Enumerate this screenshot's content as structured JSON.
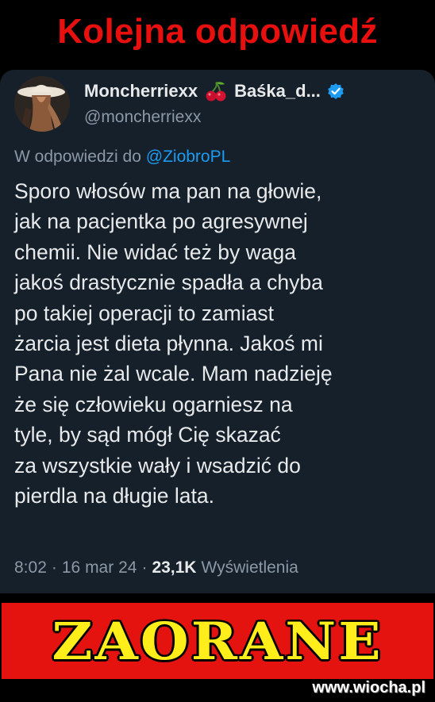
{
  "headline": "Kolejna odpowiedź",
  "tweet": {
    "display_name": "Moncherriexx",
    "display_name_suffix": "Baśka_d...",
    "handle": "@moncherriexx",
    "reply_prefix": "W odpowiedzi do",
    "reply_mention": "@ZiobroPL",
    "text_lines": [
      "Sporo włosów ma pan na głowie,",
      "jak na pacjentka po agresywnej",
      "chemii. Nie widać też by waga",
      "jakoś drastycznie spadła a chyba",
      "po takiej operacji to zamiast",
      "żarcia jest dieta płynna. Jakoś mi",
      "Pana nie żal wcale. Mam nadzieję",
      "że się człowieku ogarniesz na",
      "tyle, by sąd mógł Cię skazać",
      "za wszystkie wały i wsadzić do",
      "pierdla na długie lata."
    ],
    "time": "8:02",
    "date": "16 mar 24",
    "separator": "·",
    "views_count": "23,1K",
    "views_label": "Wyświetlenia",
    "icons": {
      "cherry": "cherry-emoji-icon",
      "verified": "verified-badge-icon"
    }
  },
  "stamp_text": "ZAORANE",
  "watermark": "www.wiocha.pl",
  "colors": {
    "headline_red": "#e8100e",
    "card_bg": "#15202b",
    "text_primary": "#e7e9ea",
    "text_secondary": "#8b98a5",
    "mention_blue": "#1d9bf0",
    "stamp_red": "#e4130f",
    "stamp_yellow": "#ffee1a"
  }
}
